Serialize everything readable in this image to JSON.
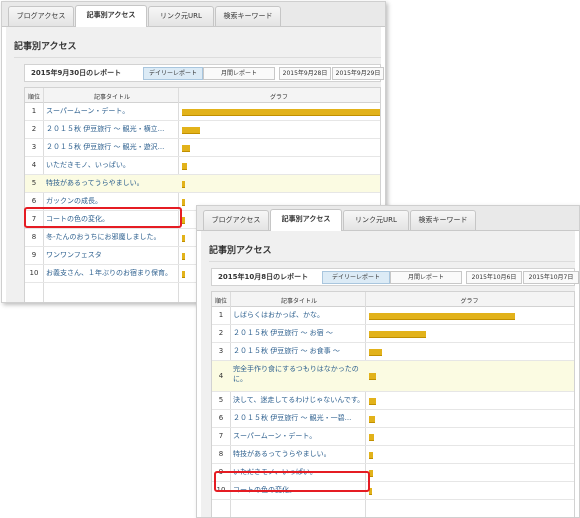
{
  "colors": {
    "bar": "#e2b21a",
    "highlight": "#e51c23",
    "active_button": "#dcebf6"
  },
  "screen1": {
    "tabs": [
      "ブログアクセス",
      "記事別アクセス",
      "リンク元URL",
      "検索キーワード"
    ],
    "active_tab": 1,
    "section_title": "記事別アクセス",
    "report_title": "2015年9月30日のレポート",
    "buttons": {
      "daily": "デイリーレポート",
      "monthly": "月間レポート",
      "date1": "2015年9月28日",
      "date2": "2015年9月29日"
    },
    "columns": {
      "rank": "順位",
      "title": "記事タイトル",
      "graph": "グラフ"
    },
    "rows": [
      {
        "rank": "1",
        "title": "スーパームーン・デート。",
        "share": 1.0
      },
      {
        "rank": "2",
        "title": "２０１５秋 伊豆旅行 ～ 観光・横立...",
        "share": 0.09
      },
      {
        "rank": "3",
        "title": "２０１５秋 伊豆旅行 ～ 観光・遊沢...",
        "share": 0.04
      },
      {
        "rank": "4",
        "title": "いただきモノ、いっぱい。",
        "share": 0.025
      },
      {
        "rank": "5",
        "title": "特技があるってうらやましい。",
        "share": 0.015
      },
      {
        "rank": "6",
        "title": "ガックンの成長。",
        "share": 0.012
      },
      {
        "rank": "7",
        "title": "コートの色の変化。",
        "share": 0.01
      },
      {
        "rank": "8",
        "title": "冬-たんのおうちにお邪魔しました。",
        "share": 0.008
      },
      {
        "rank": "9",
        "title": "ワンワンフェスタ",
        "share": 0.007
      },
      {
        "rank": "10",
        "title": "お義支さん、１年ぶりのお宿まり保育。",
        "share": 0.006
      }
    ]
  },
  "screen2": {
    "tabs": [
      "ブログアクセス",
      "記事別アクセス",
      "リンク元URL",
      "検索キーワード"
    ],
    "active_tab": 1,
    "section_title": "記事別アクセス",
    "report_title": "2015年10月8日のレポート",
    "buttons": {
      "daily": "デイリーレポート",
      "monthly": "月間レポート",
      "date1": "2015年10月6日",
      "date2": "2015年10月7日"
    },
    "columns": {
      "rank": "順位",
      "title": "記事タイトル",
      "graph": "グラフ"
    },
    "rows": [
      {
        "rank": "1",
        "title": "しばらくはおかっぱ、かな。",
        "share": 1.0
      },
      {
        "rank": "2",
        "title": "２０１５秋 伊豆旅行 ～ お宿 ～",
        "share": 0.39
      },
      {
        "rank": "3",
        "title": "２０１５秋 伊豆旅行 ～ お食事 ～",
        "share": 0.09
      },
      {
        "rank": "4",
        "title": "完全手作り食にするつもりはなかったのに。",
        "share": 0.045
      },
      {
        "rank": "5",
        "title": "決して、迷走してるわけじゃないんです。",
        "share": 0.045
      },
      {
        "rank": "6",
        "title": "２０１５秋 伊豆旅行 ～ 観光・一碧...",
        "share": 0.04
      },
      {
        "rank": "7",
        "title": "スーパームーン・デート。",
        "share": 0.035
      },
      {
        "rank": "8",
        "title": "特技があるってうらやましい。",
        "share": 0.03
      },
      {
        "rank": "9",
        "title": "いただきモノ、いっぱい。",
        "share": 0.025
      },
      {
        "rank": "10",
        "title": "コートの色の変化。",
        "share": 0.02
      }
    ]
  }
}
